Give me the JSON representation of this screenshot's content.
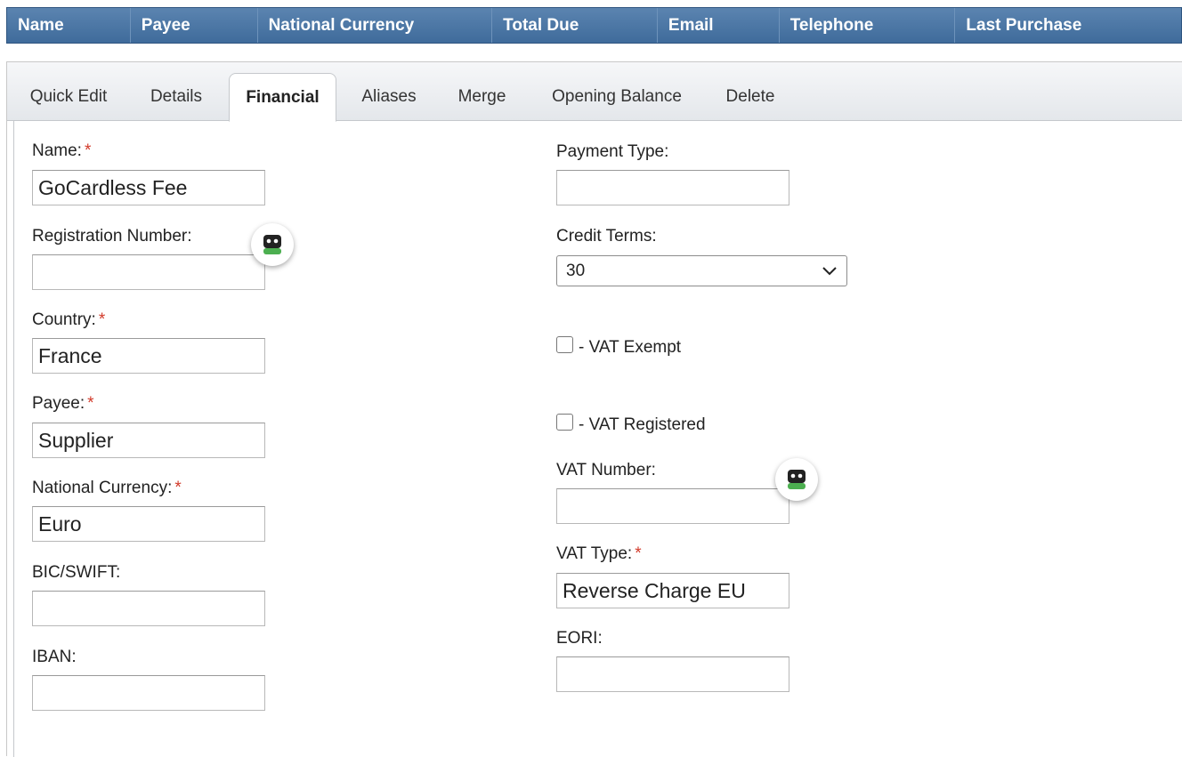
{
  "grid": {
    "columns": [
      "Name",
      "Payee",
      "National Currency",
      "Total Due",
      "Email",
      "Telephone",
      "Last Purchase"
    ]
  },
  "tabs": [
    "Quick Edit",
    "Details",
    "Financial",
    "Aliases",
    "Merge",
    "Opening Balance",
    "Delete"
  ],
  "active_tab": "Financial",
  "form": {
    "name_label": "Name:",
    "name_value": "GoCardless Fee",
    "registration_label": "Registration Number:",
    "registration_value": "",
    "country_label": "Country:",
    "country_value": "France",
    "payee_label": "Payee:",
    "payee_value": "Supplier",
    "currency_label": "National Currency:",
    "currency_value": "Euro",
    "bic_label": "BIC/SWIFT:",
    "bic_value": "",
    "iban_label": "IBAN:",
    "iban_value": "",
    "payment_type_label": "Payment Type:",
    "payment_type_value": "",
    "credit_terms_label": "Credit Terms:",
    "credit_terms_value": "30",
    "vat_exempt_label": "- VAT Exempt",
    "vat_registered_label": "- VAT Registered",
    "vat_number_label": "VAT Number:",
    "vat_number_value": "",
    "vat_type_label": "VAT Type:",
    "vat_type_value": "Reverse Charge EU",
    "eori_label": "EORI:",
    "eori_value": ""
  },
  "required_marker": "*",
  "colors": {
    "header_bg": "#4a76a4",
    "required": "#d23a2a",
    "bubble_icon": "#4caf50"
  }
}
